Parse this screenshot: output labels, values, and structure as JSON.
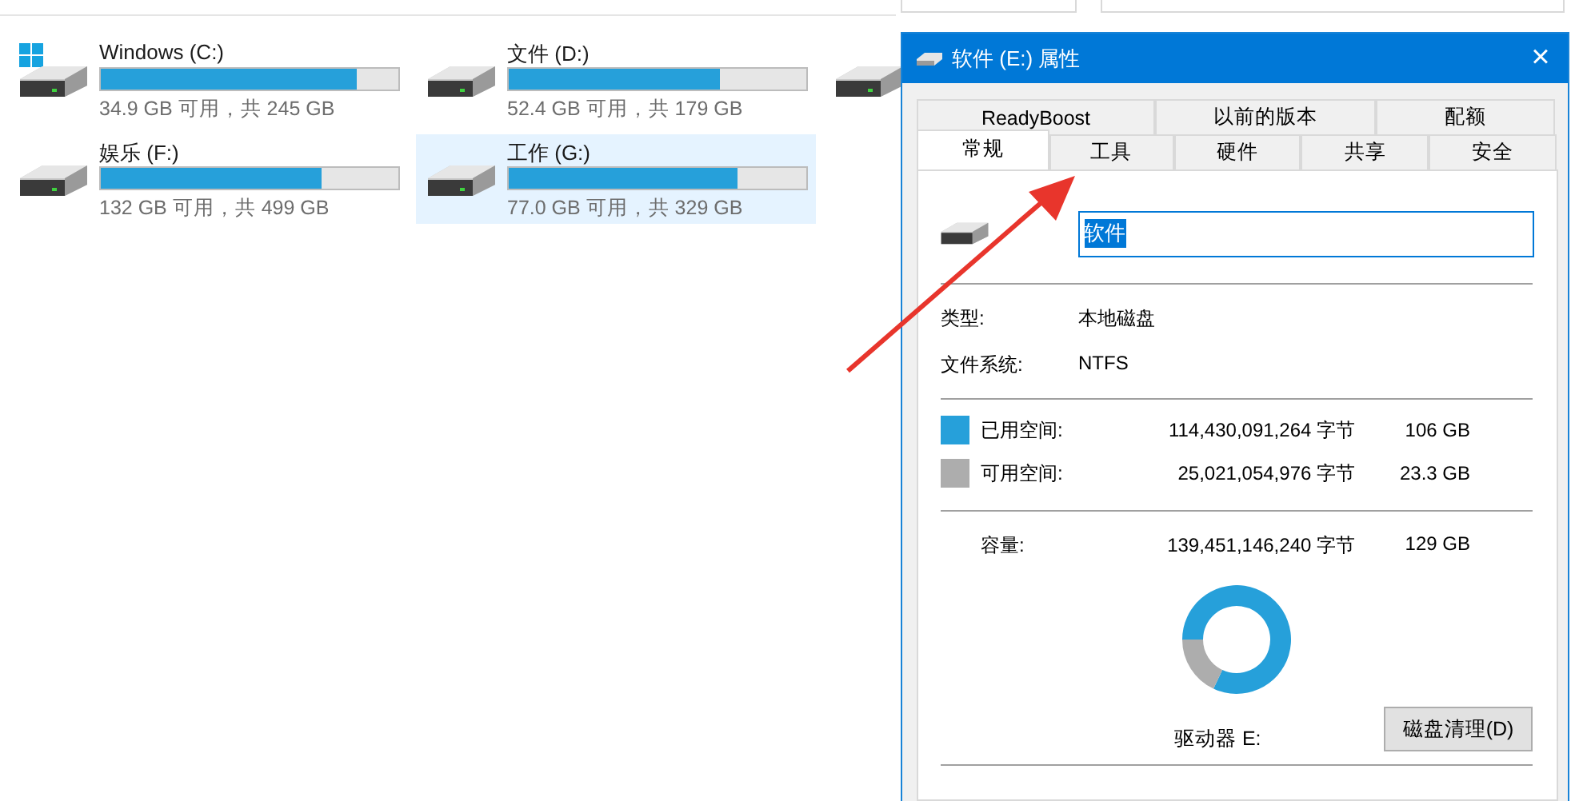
{
  "drives": [
    {
      "kind": "system",
      "name": "Windows (C:)",
      "level": 0.86,
      "free": "34.9 GB 可用，共 245 GB",
      "selected": false
    },
    {
      "kind": "disk",
      "name": "文件 (D:)",
      "level": 0.71,
      "free": "52.4 GB 可用，共 179 GB",
      "selected": false
    },
    {
      "kind": "disk",
      "selected": false
    },
    {
      "kind": "disk",
      "name": "娱乐 (F:)",
      "level": 0.74,
      "free": "132 GB 可用，共 499 GB",
      "selected": false
    },
    {
      "kind": "disk",
      "name": "工作 (G:)",
      "level": 0.77,
      "free": "77.0 GB 可用，共 329 GB",
      "selected": true
    }
  ],
  "dialog": {
    "title": "软件 (E:) 属性",
    "close": "×",
    "tab_rows": [
      [
        {
          "label": "ReadyBoost",
          "selected": false
        },
        {
          "label": "以前的版本",
          "selected": false
        },
        {
          "label": "配额",
          "selected": false
        }
      ],
      [
        {
          "label": "常规",
          "selected": true
        },
        {
          "label": "工具",
          "selected": false
        },
        {
          "label": "硬件",
          "selected": false
        },
        {
          "label": "共享",
          "selected": false
        },
        {
          "label": "安全",
          "selected": false
        }
      ]
    ],
    "name_field": {
      "value": "软件",
      "text_selected": true
    },
    "info": [
      {
        "label": "类型:",
        "value": "本地磁盘"
      },
      {
        "label": "文件系统:",
        "value": "NTFS"
      }
    ],
    "space": [
      {
        "label": "已用空间:",
        "bytes": "114,430,091,264 字节",
        "size": "106 GB",
        "color": "#26a0da"
      },
      {
        "label": "可用空间:",
        "bytes": "25,021,054,976 字节",
        "size": "23.3 GB",
        "color": "#adadad"
      }
    ],
    "capacity": {
      "label": "容量:",
      "bytes": "139,451,146,240 字节",
      "size": "129 GB"
    },
    "chart_data": {
      "type": "donut",
      "values": [
        82,
        18
      ]
    },
    "drive_label": "驱动器 E:",
    "cleanup_button": "磁盘清理(D)"
  }
}
